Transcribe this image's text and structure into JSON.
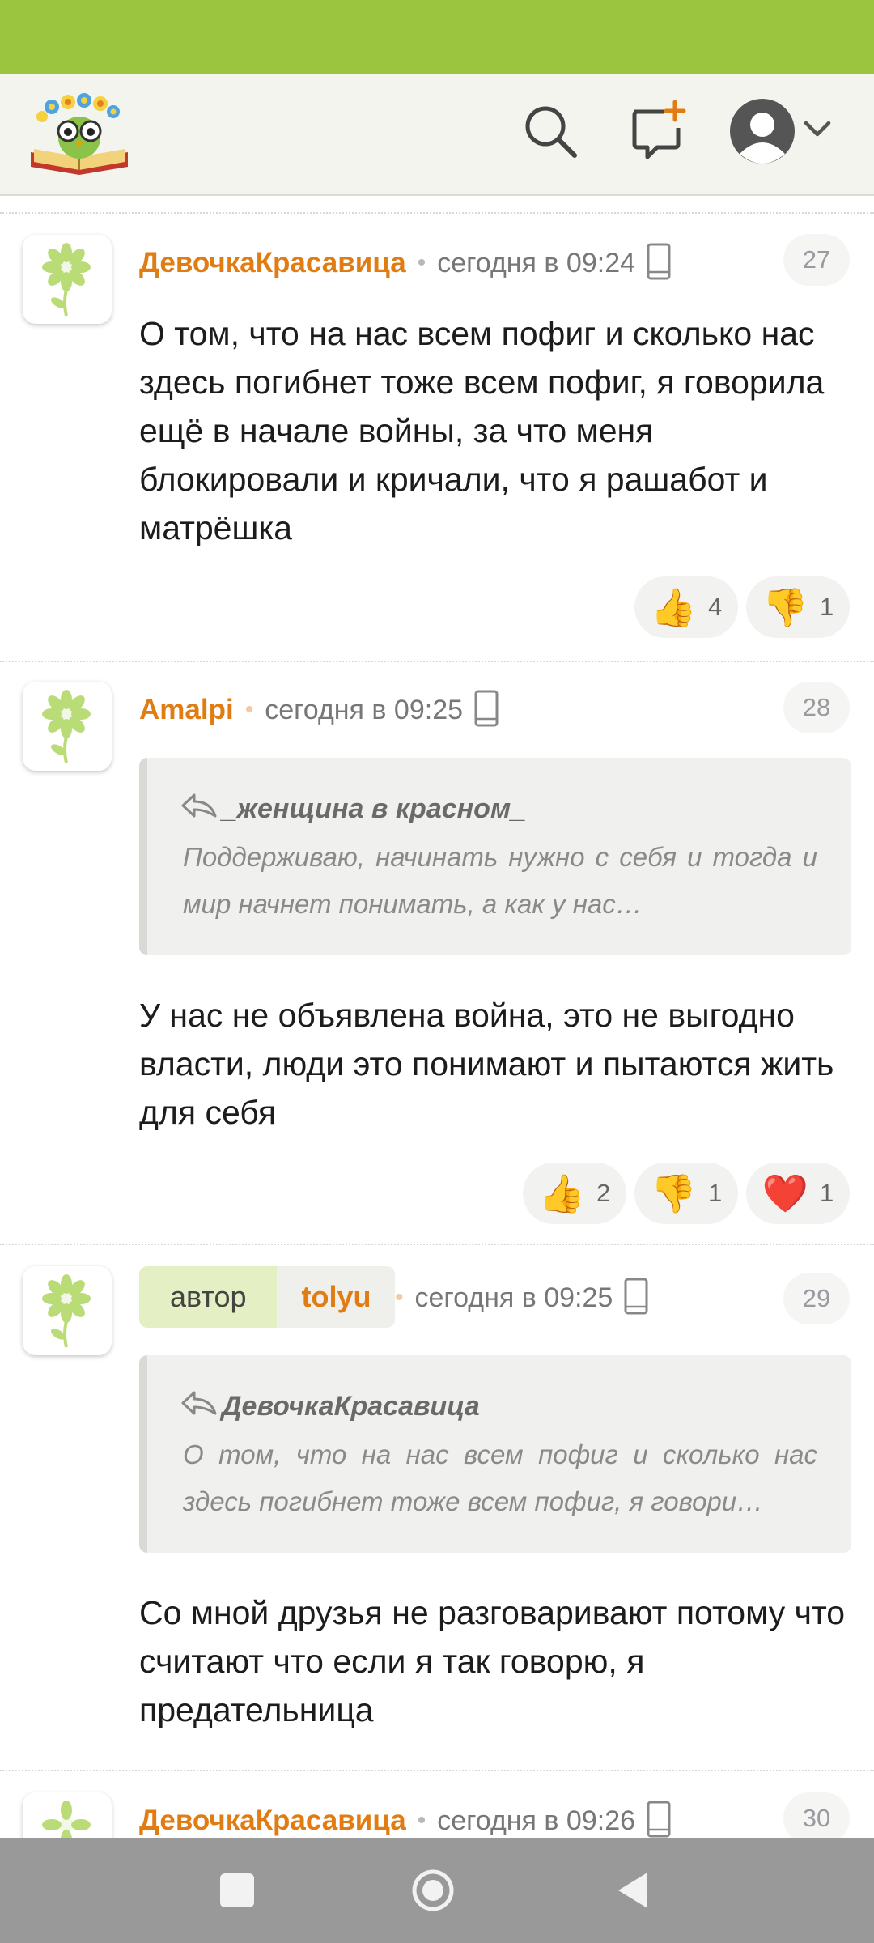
{
  "header": {
    "logo": "owl-book-logo",
    "icons": [
      "search-icon",
      "new-post-icon",
      "user-avatar-icon",
      "chevron-down-icon"
    ]
  },
  "comments": [
    {
      "author": "ДевочкаКрасавица",
      "time": "сегодня в 09:24",
      "number": "27",
      "text": "О том, что на нас всем пофиг и сколько нас здесь погибнет тоже всем пофиг, я говорила ещё в начале войны, за что меня блокировали и кричали, что я рашабот и матрёшка",
      "reactions": {
        "like": "4",
        "dislike": "1"
      }
    },
    {
      "author": "Amalpi",
      "time": "сегодня в 09:25",
      "number": "28",
      "quote": {
        "author": "_женщина в красном_",
        "text": "Поддерживаю, начинать нужно с себя и тогда и мир начнет понимать, а как у нас…"
      },
      "text": "У нас не объявлена война, это не выгодно власти, люди это понимают и пытаются жить для себя",
      "reactions": {
        "like": "2",
        "dislike": "1",
        "heart": "1"
      }
    },
    {
      "badge": "автор",
      "author": "tolyu",
      "time": "сегодня в 09:25",
      "number": "29",
      "quote": {
        "author": "ДевочкаКрасавица",
        "text": "О том, что на нас всем пофиг и сколько нас здесь погибнет тоже всем пофиг, я говори…"
      },
      "text": "Со мной друзья не разговаривают потому что считают что если я так говорю, я предательница"
    },
    {
      "author": "ДевочкаКрасавица",
      "time": "сегодня в 09:26",
      "number": "30"
    }
  ],
  "colors": {
    "status_bar": "#9bc43f",
    "username": "#e17c12",
    "header_bg": "#f4f4ee"
  }
}
